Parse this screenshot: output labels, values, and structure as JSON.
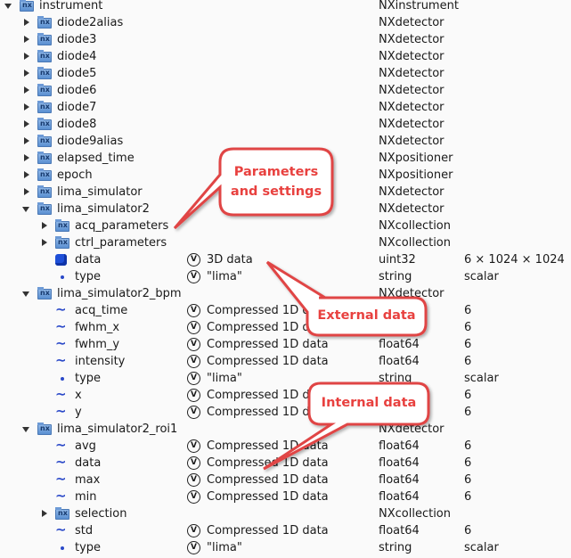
{
  "value_icon_label": "V",
  "rows": [
    {
      "level": 0,
      "expander": "expanded",
      "icon": "group",
      "name": "instrument",
      "value": "",
      "type": "NXinstrument",
      "shape": ""
    },
    {
      "level": 1,
      "expander": "collapsed",
      "icon": "group",
      "name": "diode2alias",
      "value": "",
      "type": "NXdetector",
      "shape": ""
    },
    {
      "level": 1,
      "expander": "collapsed",
      "icon": "group",
      "name": "diode3",
      "value": "",
      "type": "NXdetector",
      "shape": ""
    },
    {
      "level": 1,
      "expander": "collapsed",
      "icon": "group",
      "name": "diode4",
      "value": "",
      "type": "NXdetector",
      "shape": ""
    },
    {
      "level": 1,
      "expander": "collapsed",
      "icon": "group",
      "name": "diode5",
      "value": "",
      "type": "NXdetector",
      "shape": ""
    },
    {
      "level": 1,
      "expander": "collapsed",
      "icon": "group",
      "name": "diode6",
      "value": "",
      "type": "NXdetector",
      "shape": ""
    },
    {
      "level": 1,
      "expander": "collapsed",
      "icon": "group",
      "name": "diode7",
      "value": "",
      "type": "NXdetector",
      "shape": ""
    },
    {
      "level": 1,
      "expander": "collapsed",
      "icon": "group",
      "name": "diode8",
      "value": "",
      "type": "NXdetector",
      "shape": ""
    },
    {
      "level": 1,
      "expander": "collapsed",
      "icon": "group",
      "name": "diode9alias",
      "value": "",
      "type": "NXdetector",
      "shape": ""
    },
    {
      "level": 1,
      "expander": "collapsed",
      "icon": "group",
      "name": "elapsed_time",
      "value": "",
      "type": "NXpositioner",
      "shape": ""
    },
    {
      "level": 1,
      "expander": "collapsed",
      "icon": "group",
      "name": "epoch",
      "value": "",
      "type": "NXpositioner",
      "shape": ""
    },
    {
      "level": 1,
      "expander": "collapsed",
      "icon": "group",
      "name": "lima_simulator",
      "value": "",
      "type": "NXdetector",
      "shape": ""
    },
    {
      "level": 1,
      "expander": "expanded",
      "icon": "group",
      "name": "lima_simulator2",
      "value": "",
      "type": "NXdetector",
      "shape": ""
    },
    {
      "level": 2,
      "expander": "collapsed",
      "icon": "group",
      "name": "acq_parameters",
      "value": "",
      "type": "NXcollection",
      "shape": ""
    },
    {
      "level": 2,
      "expander": "collapsed",
      "icon": "group",
      "name": "ctrl_parameters",
      "value": "",
      "type": "NXcollection",
      "shape": ""
    },
    {
      "level": 2,
      "expander": "none",
      "icon": "cube",
      "name": "data",
      "value": "3D data",
      "type": "uint32",
      "shape": "6 × 1024 × 1024"
    },
    {
      "level": 2,
      "expander": "none",
      "icon": "dot",
      "name": "type",
      "value": "\"lima\"",
      "type": "string",
      "shape": "scalar"
    },
    {
      "level": 1,
      "expander": "expanded",
      "icon": "group",
      "name": "lima_simulator2_bpm",
      "value": "",
      "type": "NXdetector",
      "shape": ""
    },
    {
      "level": 2,
      "expander": "none",
      "icon": "curve",
      "name": "acq_time",
      "value": "Compressed 1D data",
      "type": "",
      "shape": "6"
    },
    {
      "level": 2,
      "expander": "none",
      "icon": "curve",
      "name": "fwhm_x",
      "value": "Compressed 1D data",
      "type": "",
      "shape": "6"
    },
    {
      "level": 2,
      "expander": "none",
      "icon": "curve",
      "name": "fwhm_y",
      "value": "Compressed 1D data",
      "type": "float64",
      "shape": "6"
    },
    {
      "level": 2,
      "expander": "none",
      "icon": "curve",
      "name": "intensity",
      "value": "Compressed 1D data",
      "type": "float64",
      "shape": "6"
    },
    {
      "level": 2,
      "expander": "none",
      "icon": "dot",
      "name": "type",
      "value": "\"lima\"",
      "type": "string",
      "shape": "scalar"
    },
    {
      "level": 2,
      "expander": "none",
      "icon": "curve",
      "name": "x",
      "value": "Compressed 1D data",
      "type": "",
      "shape": "6"
    },
    {
      "level": 2,
      "expander": "none",
      "icon": "curve",
      "name": "y",
      "value": "Compressed 1D data",
      "type": "",
      "shape": "6"
    },
    {
      "level": 1,
      "expander": "expanded",
      "icon": "group",
      "name": "lima_simulator2_roi1",
      "value": "",
      "type": "NXdetector",
      "shape": ""
    },
    {
      "level": 2,
      "expander": "none",
      "icon": "curve",
      "name": "avg",
      "value": "Compressed 1D data",
      "type": "float64",
      "shape": "6"
    },
    {
      "level": 2,
      "expander": "none",
      "icon": "curve",
      "name": "data",
      "value": "Compressed 1D data",
      "type": "float64",
      "shape": "6"
    },
    {
      "level": 2,
      "expander": "none",
      "icon": "curve",
      "name": "max",
      "value": "Compressed 1D data",
      "type": "float64",
      "shape": "6"
    },
    {
      "level": 2,
      "expander": "none",
      "icon": "curve",
      "name": "min",
      "value": "Compressed 1D data",
      "type": "float64",
      "shape": "6"
    },
    {
      "level": 2,
      "expander": "collapsed",
      "icon": "group",
      "name": "selection",
      "value": "",
      "type": "NXcollection",
      "shape": ""
    },
    {
      "level": 2,
      "expander": "none",
      "icon": "curve",
      "name": "std",
      "value": "Compressed 1D data",
      "type": "float64",
      "shape": "6"
    },
    {
      "level": 2,
      "expander": "none",
      "icon": "dot",
      "name": "type",
      "value": "\"lima\"",
      "type": "string",
      "shape": "scalar"
    }
  ],
  "callouts": {
    "params": "Parameters and settings",
    "external": "External data",
    "internal": "Internal data"
  },
  "colors": {
    "callout_border": "#e04444",
    "callout_text": "#e8413f",
    "icon_blue": "#2a49c8"
  }
}
